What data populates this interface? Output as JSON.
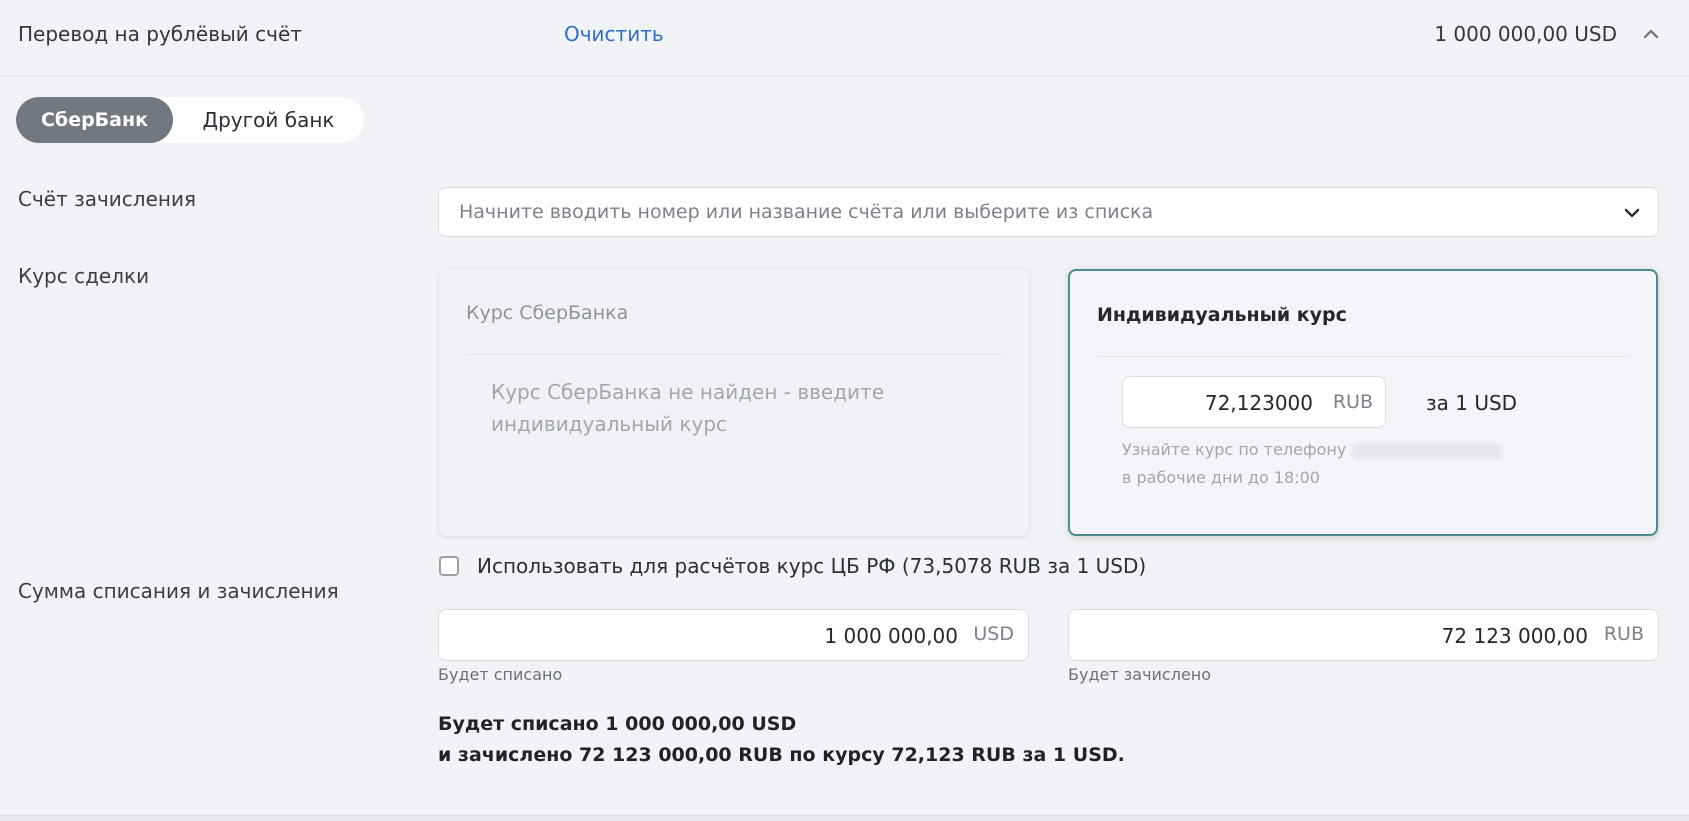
{
  "header": {
    "title": "Перевод на рублёвый счёт",
    "clear_label": "Очистить",
    "amount": "1 000 000,00 USD"
  },
  "bank_selector": {
    "options": [
      "СберБанк",
      "Другой банк"
    ],
    "selected": "СберБанк"
  },
  "account": {
    "label": "Счёт зачисления",
    "placeholder": "Начните вводить номер или название счёта или выберите из списка"
  },
  "rate": {
    "label": "Курс сделки",
    "sber_card": {
      "title": "Курс СберБанка",
      "message": "Курс СберБанка не найден - введите индивидуальный курс"
    },
    "individual_card": {
      "title": "Индивидуальный курс",
      "value": "72,123000",
      "unit": "RUB",
      "per": "за 1 USD",
      "hint_line1": "Узнайте курс по телефону",
      "hint_line2": "в рабочие дни до 18:00"
    },
    "cb_checkbox": {
      "label": "Использовать для расчётов курс ЦБ РФ (73,5078 RUB за 1 USD)",
      "checked": false
    }
  },
  "amounts": {
    "label": "Сумма списания и зачисления",
    "debit": {
      "value": "1 000 000,00",
      "unit": "USD",
      "caption": "Будет списано"
    },
    "credit": {
      "value": "72 123 000,00",
      "unit": "RUB",
      "caption": "Будет зачислено"
    }
  },
  "summary": {
    "line1": "Будет списано 1 000 000,00 USD",
    "line2": "и зачислено 72 123 000,00 RUB по курсу 72,123 RUB за 1 USD."
  },
  "colors": {
    "accent": "#2f6ec8",
    "selected_card_border": "#4a8b8f",
    "segment_active": "#737880"
  },
  "icons": {
    "header_toggle": "chevron-up-icon",
    "select_toggle": "chevron-down-icon"
  }
}
